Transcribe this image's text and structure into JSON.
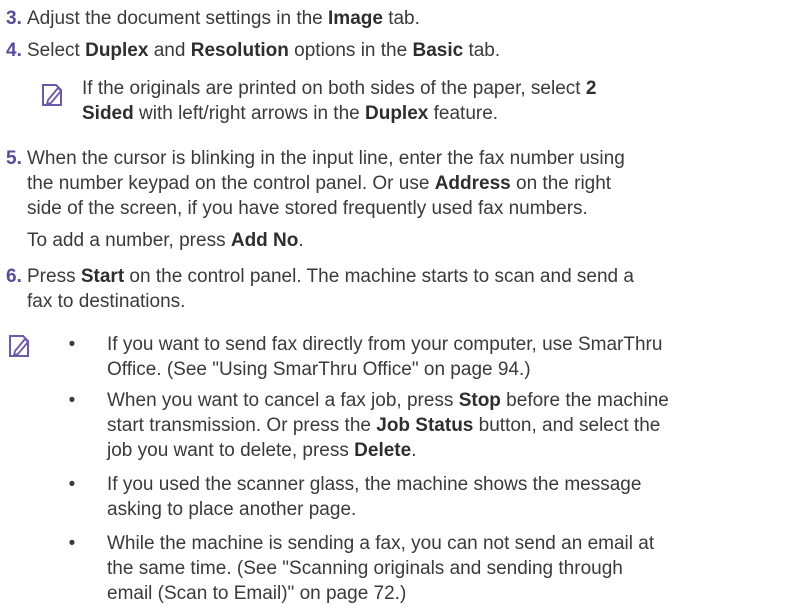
{
  "steps": {
    "s3": {
      "num": "3.",
      "t1": "Adjust the document settings in the ",
      "b1": "Image",
      "t2": " tab."
    },
    "s4": {
      "num": "4.",
      "t1": "Select ",
      "b1": "Duplex",
      "t2": " and ",
      "b2": "Resolution",
      "t3": " options in the ",
      "b3": "Basic",
      "t4": " tab."
    },
    "note1": {
      "l1_t1": "If the originals are printed on both sides of the paper, select ",
      "l1_b1": "2",
      "l2_b1": "Sided",
      "l2_t1": " with left/right arrows in the ",
      "l2_b2": "Duplex",
      "l2_t2": " feature."
    },
    "s5": {
      "num": "5.",
      "l1": "When the cursor is blinking in the input line, enter the fax number using",
      "l2": "the number keypad on the control panel. Or use ",
      "l2_b": "Address",
      "l2_t": " on the right",
      "l3": "side of the screen, if you have stored frequently used fax numbers.",
      "l4_t": "To add a number, press ",
      "l4_b": "Add No",
      "l4_end": "."
    },
    "s6": {
      "num": "6.",
      "l1_t1": "Press ",
      "l1_b": "Start",
      "l1_t2": " on the control panel. The machine starts to scan and send a",
      "l2": "fax to destinations."
    }
  },
  "notes": {
    "b1": {
      "l1": "If you want to send fax directly from your computer, use SmarThru",
      "l2": "Office. (See \"Using SmarThru Office\" on page 94.)"
    },
    "b2": {
      "l1_t1": "When you want to cancel a fax job, press ",
      "l1_b": "Stop",
      "l1_t2": " before the machine",
      "l2_t1": "start transmission. Or press the ",
      "l2_b": "Job Status",
      "l2_t2": " button, and select the",
      "l3_t1": "job you want to delete, press ",
      "l3_b": "Delete",
      "l3_t2": "."
    },
    "b3": {
      "l1": "If you used the scanner glass, the machine shows the message",
      "l2": "asking to place another page."
    },
    "b4": {
      "l1": "While the machine is sending a fax, you can not send an email at",
      "l2": "the same time. (See \"Scanning originals and sending through",
      "l3": "email (Scan to Email)\" on page 72.)"
    },
    "bullet": "•"
  }
}
